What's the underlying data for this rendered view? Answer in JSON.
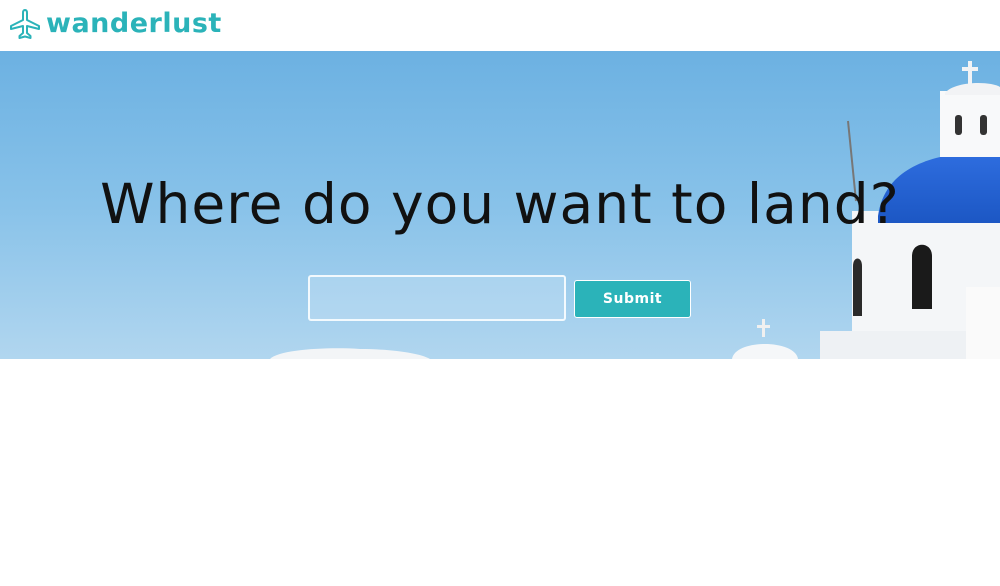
{
  "brand": {
    "name": "wanderlust",
    "logo_icon": "airplane-icon",
    "accent_color": "#2bb3b9"
  },
  "hero": {
    "title": "Where do you want to land?",
    "background": "santorini-church-sky-photo"
  },
  "search": {
    "value": "",
    "placeholder": ""
  },
  "submit": {
    "label": "Submit"
  }
}
